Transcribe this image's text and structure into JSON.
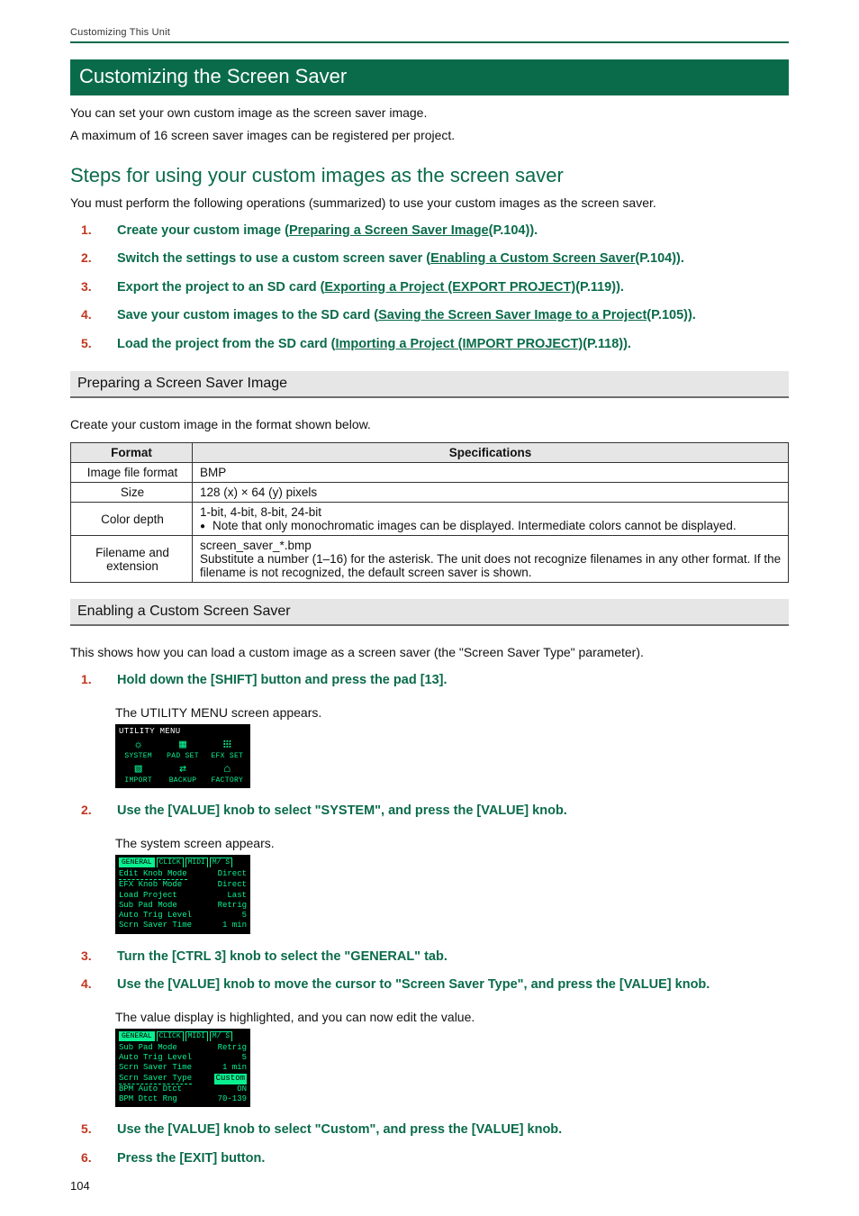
{
  "header": {
    "breadcrumb": "Customizing This Unit"
  },
  "h1": "Customizing the Screen Saver",
  "intro1": "You can set your own custom image as the screen saver image.",
  "intro2": "A maximum of 16 screen saver images can be registered per project.",
  "h2_steps": "Steps for using your custom images as the screen saver",
  "steps_intro": "You must perform the following operations (summarized) to use your custom images as the screen saver.",
  "steps": [
    {
      "n": "1.",
      "pre": "Create your custom image (",
      "link": "Preparing a Screen Saver Image",
      "post": "(P.104))."
    },
    {
      "n": "2.",
      "pre": "Switch the settings to use a custom screen saver (",
      "link": "Enabling a Custom Screen Saver",
      "post": "(P.104))."
    },
    {
      "n": "3.",
      "pre": "Export the project to an SD card (",
      "link": "Exporting a Project (EXPORT PROJECT)",
      "post": "(P.119))."
    },
    {
      "n": "4.",
      "pre": "Save your custom images to the SD card (",
      "link": "Saving the Screen Saver Image to a Project",
      "post": "(P.105))."
    },
    {
      "n": "5.",
      "pre": "Load the project from the SD card (",
      "link": "Importing a Project (IMPORT PROJECT)",
      "post": "(P.118))."
    }
  ],
  "h3_prepare": "Preparing a Screen Saver Image",
  "prepare_intro": "Create your custom image in the format shown below.",
  "table": {
    "head_format": "Format",
    "head_spec": "Specifications",
    "rows": {
      "fmt_label": "Image file format",
      "fmt_val": "BMP",
      "size_label": "Size",
      "size_val": "128 (x) × 64 (y) pixels",
      "depth_label": "Color depth",
      "depth_line1": "1-bit, 4-bit, 8-bit, 24-bit",
      "depth_line2": "Note that only monochromatic images can be displayed. Intermediate colors cannot be displayed.",
      "fn_label": "Filename and extension",
      "fn_line1": "screen_saver_*.bmp",
      "fn_line2": "Substitute a number (1–16) for the asterisk. The unit does not recognize filenames in any other format. If the filename is not recognized, the default screen saver is shown."
    }
  },
  "h3_enable": "Enabling a Custom Screen Saver",
  "enable_intro": "This shows how you can load a custom image as a screen saver (the \"Screen Saver Type\" parameter).",
  "proc": {
    "s1_n": "1.",
    "s1": "Hold down the [SHIFT] button and press the pad [13].",
    "s1_note": "The UTILITY MENU screen appears.",
    "s2_n": "2.",
    "s2": "Use the [VALUE] knob to select \"SYSTEM\", and press the [VALUE] knob.",
    "s2_note": "The system screen appears.",
    "s3_n": "3.",
    "s3": "Turn the [CTRL 3] knob to select the \"GENERAL\" tab.",
    "s4_n": "4.",
    "s4": "Use the [VALUE] knob to move the cursor to \"Screen Saver Type\", and press the [VALUE] knob.",
    "s4_note": "The value display is highlighted, and you can now edit the value.",
    "s5_n": "5.",
    "s5": "Use the [VALUE] knob to select \"Custom\", and press the [VALUE] knob.",
    "s6_n": "6.",
    "s6": "Press the [EXIT] button."
  },
  "util_screen": {
    "title": "UTILITY MENU",
    "items": [
      "SYSTEM",
      "PAD SET",
      "EFX SET",
      "IMPORT",
      "BACKUP",
      "FACTORY"
    ]
  },
  "sys_screen1": {
    "tabs": [
      "GENERAL",
      "CLICK",
      "MIDI",
      "M/ S"
    ],
    "rows": [
      {
        "l": "Edit Knob Mode",
        "r": "Direct"
      },
      {
        "l": "EFX Knob Mode",
        "r": "Direct"
      },
      {
        "l": "Load Project",
        "r": "Last"
      },
      {
        "l": "Sub Pad Mode",
        "r": "Retrig"
      },
      {
        "l": "Auto Trig Level",
        "r": "5"
      },
      {
        "l": "Scrn Saver Time",
        "r": "1 min"
      }
    ]
  },
  "sys_screen2": {
    "tabs": [
      "GENERAL",
      "CLICK",
      "MIDI",
      "M/ S"
    ],
    "rows": [
      {
        "l": "Sub Pad Mode",
        "r": "Retrig"
      },
      {
        "l": "Auto Trig Level",
        "r": "5"
      },
      {
        "l": "Scrn Saver Time",
        "r": "1 min"
      },
      {
        "l": "Scrn Saver Type",
        "r": "Custom"
      },
      {
        "l": "BPM Auto Dtct",
        "r": "ON"
      },
      {
        "l": "BPM Dtct Rng",
        "r": "70-139"
      }
    ]
  },
  "page_number": "104"
}
